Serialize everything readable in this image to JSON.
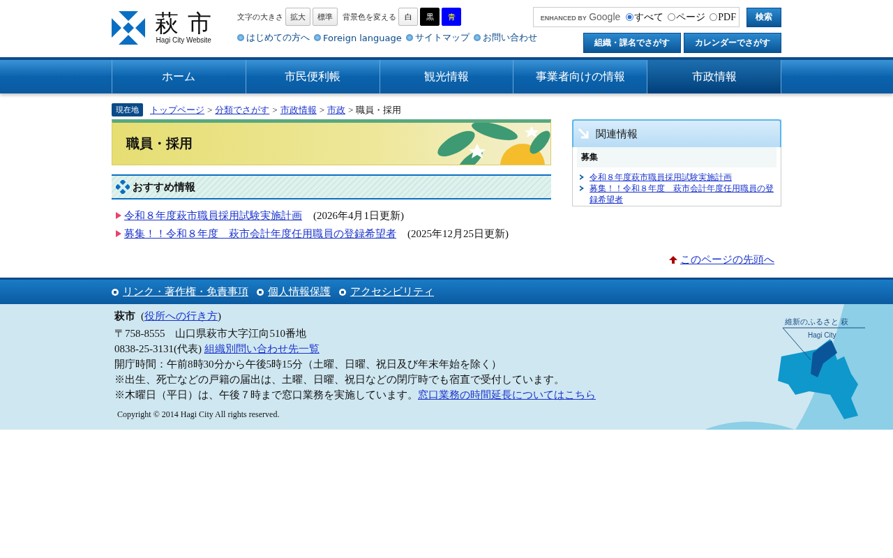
{
  "header": {
    "logo": {
      "name": "萩 市",
      "subtitle": "Hagi City Website"
    },
    "font_size": {
      "label": "文字の大きさ",
      "buttons": [
        "拡大",
        "標準"
      ]
    },
    "background": {
      "label": "背景色を変える",
      "options": [
        {
          "label": "白",
          "kind": "white"
        },
        {
          "label": "黒",
          "kind": "black"
        },
        {
          "label": "青",
          "kind": "blue"
        }
      ]
    },
    "quick_links": [
      "はじめての方へ",
      "Foreign language",
      "サイトマップ",
      "お問い合わせ"
    ],
    "search": {
      "brand": "ENHANCED BY",
      "brand_name": "Google",
      "scopes": [
        {
          "label": "すべて",
          "selected": true
        },
        {
          "label": "ページ",
          "selected": false
        },
        {
          "label": "PDF",
          "selected": false
        }
      ],
      "button": "検索"
    },
    "find_buttons": [
      "組織・課名でさがす",
      "カレンダーでさがす"
    ]
  },
  "nav": [
    {
      "label": "ホーム",
      "selected": false
    },
    {
      "label": "市民便利帳",
      "selected": false
    },
    {
      "label": "観光情報",
      "selected": false
    },
    {
      "label": "事業者向けの情報",
      "selected": false
    },
    {
      "label": "市政情報",
      "selected": true
    }
  ],
  "breadcrumb": {
    "label": "現在地",
    "separator": ">",
    "links": [
      "トップページ",
      "分類でさがす",
      "市政情報",
      "市政"
    ],
    "current": "職員・採用"
  },
  "page_title": "職員・採用",
  "recommended": {
    "heading": "おすすめ情報",
    "items": [
      {
        "title": "令和８年度萩市職員採用試験実施計画",
        "date": "(2026年4月1日更新)"
      },
      {
        "title": "募集！！令和８年度　萩市会計年度任用職員の登録希望者",
        "date": "(2025年12月25日更新)"
      }
    ]
  },
  "related": {
    "heading": "関連情報",
    "group": "募集",
    "links": [
      "令和８年度萩市職員採用試験実施計画",
      "募集！！令和８年度　萩市会計年度任用職員の登録希望者"
    ]
  },
  "page_top": "このページの先頭へ",
  "footer": {
    "links": [
      "リンク・著作権・免責事項",
      "個人情報保護",
      "アクセシビリティ"
    ],
    "org": "萩市",
    "access_open": "(",
    "access_link": "役所への行き方",
    "access_close": ")",
    "address": "〒758-8555　山口県萩市大字江向510番地",
    "phone": "0838-25-3131(代表)",
    "phone_link": "組織別問い合わせ先一覧",
    "hours": "開庁時間：午前8時30分から午後5時15分（土曜、日曜、祝日及び年末年始を除く）",
    "note": "※出生、死亡などの戸籍の届出は、土曜、日曜、祝日などの閉庁時でも宿直で受付しています。",
    "note2": "※木曜日（平日）は、午後７時まで窓口業務を実施しています。",
    "note2_link": "窓口業務の時間延長についてはこちら",
    "copyright": "Copyright © 2014 Hagi City All rights reserved.",
    "map_caption": "維新のふるさと 萩",
    "map_subcaption": "Hagi City"
  }
}
